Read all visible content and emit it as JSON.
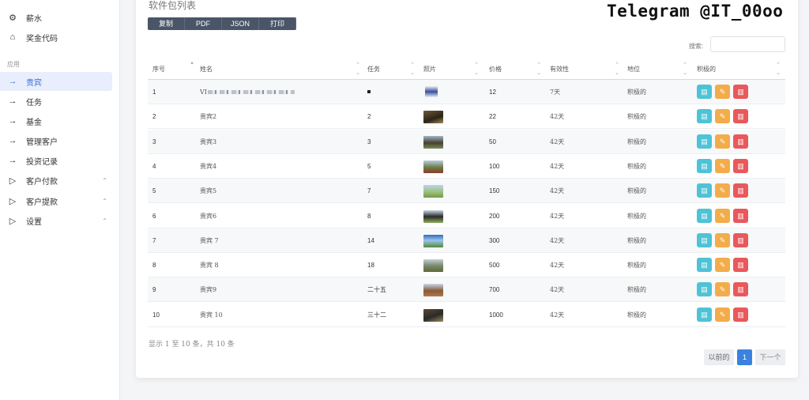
{
  "sidebar": {
    "items": [
      {
        "label": "薪水",
        "icon": "cog-icon"
      },
      {
        "label": "奖金代码",
        "icon": "home-icon"
      }
    ],
    "section_label": "应用",
    "nav": [
      {
        "label": "贵宾",
        "icon": "arrow-right-icon",
        "active": true
      },
      {
        "label": "任务",
        "icon": "arrow-right-icon"
      },
      {
        "label": "基金",
        "icon": "arrow-right-icon"
      },
      {
        "label": "管理客户",
        "icon": "arrow-right-icon"
      },
      {
        "label": "投资记录",
        "icon": "arrow-right-icon"
      },
      {
        "label": "客户付款",
        "icon": "play-icon",
        "chevron": "⌃"
      },
      {
        "label": "客户提款",
        "icon": "play-icon",
        "chevron": "⌃"
      },
      {
        "label": "设置",
        "icon": "play-icon",
        "chevron": "⌃"
      }
    ]
  },
  "card": {
    "title": "软件包列表",
    "buttons": [
      "复制",
      "PDF",
      "JSON",
      "打印"
    ],
    "search_label": "搜索:",
    "search_value": ""
  },
  "table": {
    "columns": [
      "序号",
      "姓名",
      "任务",
      "照片",
      "价格",
      "有效性",
      "地位",
      "积极的"
    ],
    "rows": [
      {
        "no": "1",
        "name": "VI",
        "task": "",
        "price": "12",
        "validity": "7天",
        "status": "积极的"
      },
      {
        "no": "2",
        "name": "贵宾2",
        "task": "2",
        "price": "22",
        "validity": "42天",
        "status": "积极的"
      },
      {
        "no": "3",
        "name": "贵宾3",
        "task": "3",
        "price": "50",
        "validity": "42天",
        "status": "积极的"
      },
      {
        "no": "4",
        "name": "贵宾4",
        "task": "5",
        "price": "100",
        "validity": "42天",
        "status": "积极的"
      },
      {
        "no": "5",
        "name": "贵宾5",
        "task": "7",
        "price": "150",
        "validity": "42天",
        "status": "积极的"
      },
      {
        "no": "6",
        "name": "贵宾6",
        "task": "8",
        "price": "200",
        "validity": "42天",
        "status": "积极的"
      },
      {
        "no": "7",
        "name": "贵宾 7",
        "task": "14",
        "price": "300",
        "validity": "42天",
        "status": "积极的"
      },
      {
        "no": "8",
        "name": "贵宾 8",
        "task": "18",
        "price": "500",
        "validity": "42天",
        "status": "积极的"
      },
      {
        "no": "9",
        "name": "贵宾9",
        "task": "二十五",
        "price": "700",
        "validity": "42天",
        "status": "积极的"
      },
      {
        "no": "10",
        "name": "贵宾 10",
        "task": "三十二",
        "price": "1000",
        "validity": "42天",
        "status": "积极的"
      }
    ]
  },
  "footer": {
    "info": "显示 1 至 10 条，共 10 条",
    "prev": "以前的",
    "current_page": "1",
    "next": "下一个"
  },
  "watermark": "Telegram @IT_00oo",
  "colors": {
    "accent": "#3b82e0",
    "view": "#4ec3d6",
    "edit": "#f3ac4a",
    "delete": "#e9585b",
    "toolbar": "#4a5568"
  }
}
